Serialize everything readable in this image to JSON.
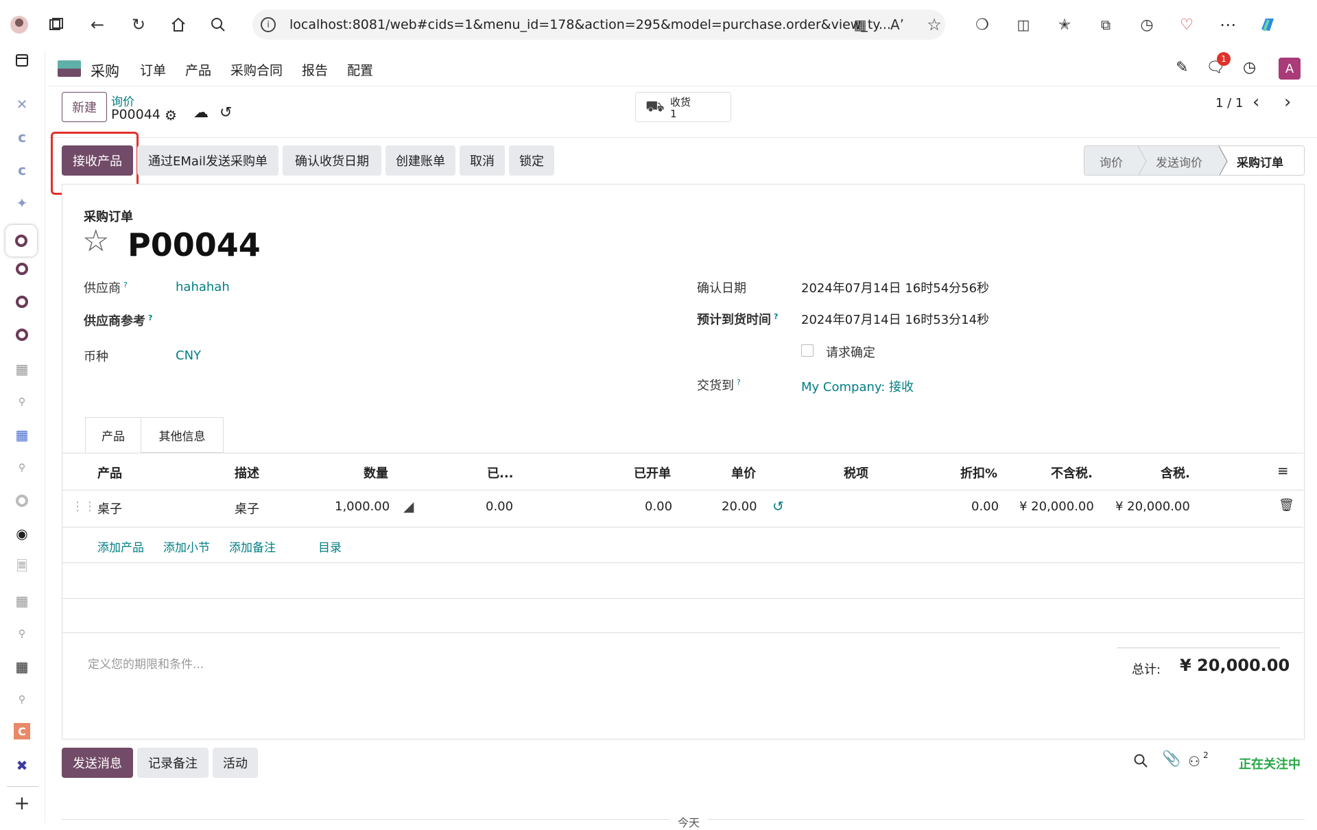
{
  "browser": {
    "url": "localhost:8081/web#cids=1&menu_id=178&action=295&model=purchase.order&view_ty..."
  },
  "app": {
    "name": "采购",
    "menu": [
      "订单",
      "产品",
      "采购合同",
      "报告",
      "配置"
    ],
    "messages_badge": "1",
    "avatar_letter": "A"
  },
  "control": {
    "new_label": "新建",
    "breadcrumb_parent": "询价",
    "record_name": "P00044",
    "receipt_label": "收货",
    "receipt_count": "1",
    "pager": "1 / 1"
  },
  "actions": {
    "receive": "接收产品",
    "email": "通过EMail发送采购单",
    "confirm_date": "确认收货日期",
    "create_bill": "创建账单",
    "cancel": "取消",
    "lock": "锁定"
  },
  "status": [
    "询价",
    "发送询价",
    "采购订单"
  ],
  "form": {
    "type_label": "采购订单",
    "title": "P00044",
    "vendor_label": "供应商",
    "vendor_value": "hahahah",
    "vendor_ref_label": "供应商参考",
    "currency_label": "币种",
    "currency_value": "CNY",
    "confirm_date_label": "确认日期",
    "confirm_date_value": "2024年07月14日 16时54分56秒",
    "expected_label": "预计到货时间",
    "expected_value": "2024年07月14日 16时53分14秒",
    "ask_confirm_label": "请求确定",
    "deliver_to_label": "交货到",
    "deliver_to_value": "My Company: 接收",
    "help_mark": "?"
  },
  "tabs": [
    "产品",
    "其他信息"
  ],
  "table": {
    "headers": [
      "产品",
      "描述",
      "数量",
      "已...",
      "已开单",
      "单价",
      "税项",
      "折扣%",
      "不含税.",
      "含税."
    ],
    "row": {
      "product": "桌子",
      "description": "桌子",
      "quantity": "1,000.00",
      "received": "0.00",
      "billed": "0.00",
      "unit_price": "20.00",
      "discount": "0.00",
      "subtotal": "¥ 20,000.00",
      "total": "¥ 20,000.00"
    },
    "add_links": [
      "添加产品",
      "添加小节",
      "添加备注",
      "目录"
    ]
  },
  "terms_placeholder": "定义您的期限和条件...",
  "total_label": "总计:",
  "total_value": "¥ 20,000.00",
  "chatter": {
    "send_message": "发送消息",
    "log_note": "记录备注",
    "activity": "活动",
    "followers_count": "2",
    "following": "正在关注中",
    "today_label": "今天"
  },
  "colors": {
    "primary": "#714b67",
    "link": "#017e84",
    "highlight": "#e0312b"
  }
}
